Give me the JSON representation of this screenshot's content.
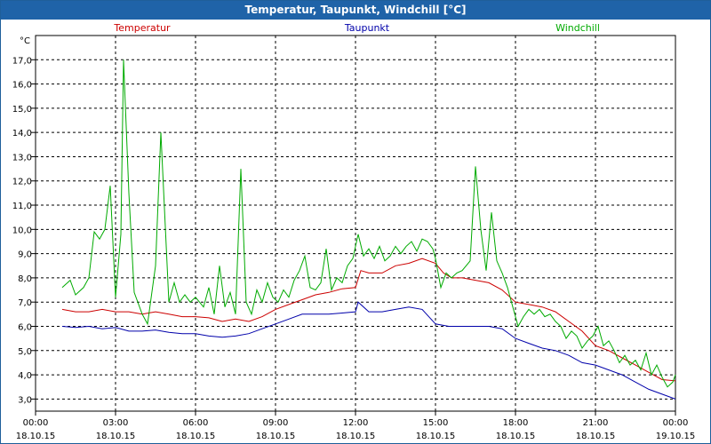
{
  "window": {
    "title": "Temperatur, Taupunkt, Windchill [°C]"
  },
  "chart_data": {
    "type": "line",
    "ylabel": "°C",
    "ylim": [
      2.5,
      18.0
    ],
    "xlim": [
      0,
      24
    ],
    "grid": true,
    "legend_placement": "top",
    "yticks": [
      3.0,
      4.0,
      5.0,
      6.0,
      7.0,
      8.0,
      9.0,
      10.0,
      11.0,
      12.0,
      13.0,
      14.0,
      15.0,
      16.0,
      17.0
    ],
    "ytick_labels": [
      "3,0",
      "4,0",
      "5,0",
      "6,0",
      "7,0",
      "8,0",
      "9,0",
      "10,0",
      "11,0",
      "12,0",
      "13,0",
      "14,0",
      "15,0",
      "16,0",
      "17,0"
    ],
    "xticks": [
      {
        "x": 0,
        "time": "00:00",
        "date": "18.10.15"
      },
      {
        "x": 3,
        "time": "03:00",
        "date": "18.10.15"
      },
      {
        "x": 6,
        "time": "06:00",
        "date": "18.10.15"
      },
      {
        "x": 9,
        "time": "09:00",
        "date": "18.10.15"
      },
      {
        "x": 12,
        "time": "12:00",
        "date": "18.10.15"
      },
      {
        "x": 15,
        "time": "15:00",
        "date": "18.10.15"
      },
      {
        "x": 18,
        "time": "18:00",
        "date": "18.10.15"
      },
      {
        "x": 21,
        "time": "21:00",
        "date": "18.10.15"
      },
      {
        "x": 24,
        "time": "00:00",
        "date": "19.10.15"
      }
    ],
    "series": [
      {
        "name": "Temperatur",
        "color": "#cc0000",
        "points": [
          [
            1.0,
            6.7
          ],
          [
            1.5,
            6.6
          ],
          [
            2.0,
            6.6
          ],
          [
            2.5,
            6.7
          ],
          [
            3.0,
            6.6
          ],
          [
            3.5,
            6.6
          ],
          [
            4.0,
            6.5
          ],
          [
            4.5,
            6.6
          ],
          [
            5.0,
            6.5
          ],
          [
            5.5,
            6.4
          ],
          [
            6.0,
            6.4
          ],
          [
            6.5,
            6.35
          ],
          [
            7.0,
            6.2
          ],
          [
            7.5,
            6.3
          ],
          [
            8.0,
            6.2
          ],
          [
            8.5,
            6.4
          ],
          [
            9.0,
            6.7
          ],
          [
            9.5,
            6.9
          ],
          [
            10.0,
            7.1
          ],
          [
            10.5,
            7.3
          ],
          [
            11.0,
            7.4
          ],
          [
            11.5,
            7.55
          ],
          [
            12.0,
            7.6
          ],
          [
            12.2,
            8.3
          ],
          [
            12.5,
            8.2
          ],
          [
            13.0,
            8.2
          ],
          [
            13.5,
            8.5
          ],
          [
            14.0,
            8.6
          ],
          [
            14.5,
            8.8
          ],
          [
            15.0,
            8.6
          ],
          [
            15.3,
            8.2
          ],
          [
            15.6,
            8.0
          ],
          [
            16.0,
            8.0
          ],
          [
            16.5,
            7.9
          ],
          [
            17.0,
            7.8
          ],
          [
            17.5,
            7.5
          ],
          [
            18.0,
            7.0
          ],
          [
            18.5,
            6.9
          ],
          [
            19.0,
            6.8
          ],
          [
            19.5,
            6.6
          ],
          [
            20.0,
            6.2
          ],
          [
            20.5,
            5.8
          ],
          [
            21.0,
            5.2
          ],
          [
            21.5,
            5.0
          ],
          [
            22.0,
            4.7
          ],
          [
            22.5,
            4.4
          ],
          [
            23.0,
            4.1
          ],
          [
            23.5,
            3.8
          ],
          [
            24.0,
            3.75
          ]
        ]
      },
      {
        "name": "Taupunkt",
        "color": "#0000aa",
        "points": [
          [
            1.0,
            6.0
          ],
          [
            1.5,
            5.95
          ],
          [
            2.0,
            6.0
          ],
          [
            2.5,
            5.9
          ],
          [
            3.0,
            5.95
          ],
          [
            3.5,
            5.8
          ],
          [
            4.0,
            5.8
          ],
          [
            4.5,
            5.85
          ],
          [
            5.0,
            5.75
          ],
          [
            5.5,
            5.7
          ],
          [
            6.0,
            5.7
          ],
          [
            6.5,
            5.6
          ],
          [
            7.0,
            5.55
          ],
          [
            7.5,
            5.6
          ],
          [
            8.0,
            5.7
          ],
          [
            8.5,
            5.9
          ],
          [
            9.0,
            6.1
          ],
          [
            9.5,
            6.3
          ],
          [
            10.0,
            6.5
          ],
          [
            10.5,
            6.5
          ],
          [
            11.0,
            6.5
          ],
          [
            11.5,
            6.55
          ],
          [
            12.0,
            6.6
          ],
          [
            12.1,
            7.0
          ],
          [
            12.5,
            6.6
          ],
          [
            13.0,
            6.6
          ],
          [
            13.5,
            6.7
          ],
          [
            14.0,
            6.8
          ],
          [
            14.5,
            6.7
          ],
          [
            15.0,
            6.1
          ],
          [
            15.5,
            6.0
          ],
          [
            16.0,
            6.0
          ],
          [
            16.5,
            6.0
          ],
          [
            17.0,
            6.0
          ],
          [
            17.5,
            5.9
          ],
          [
            18.0,
            5.5
          ],
          [
            18.5,
            5.3
          ],
          [
            19.0,
            5.1
          ],
          [
            19.5,
            5.0
          ],
          [
            20.0,
            4.8
          ],
          [
            20.5,
            4.5
          ],
          [
            21.0,
            4.4
          ],
          [
            21.5,
            4.2
          ],
          [
            22.0,
            4.0
          ],
          [
            22.5,
            3.7
          ],
          [
            23.0,
            3.4
          ],
          [
            23.5,
            3.2
          ],
          [
            24.0,
            3.0
          ]
        ]
      },
      {
        "name": "Windchill",
        "color": "#00aa00",
        "points": [
          [
            1.0,
            7.6
          ],
          [
            1.3,
            7.9
          ],
          [
            1.5,
            7.3
          ],
          [
            1.8,
            7.6
          ],
          [
            2.0,
            8.0
          ],
          [
            2.2,
            9.9
          ],
          [
            2.4,
            9.6
          ],
          [
            2.6,
            10.0
          ],
          [
            2.8,
            11.8
          ],
          [
            3.0,
            7.2
          ],
          [
            3.2,
            9.8
          ],
          [
            3.3,
            17.0
          ],
          [
            3.5,
            11.5
          ],
          [
            3.7,
            7.4
          ],
          [
            4.0,
            6.5
          ],
          [
            4.2,
            6.1
          ],
          [
            4.5,
            8.5
          ],
          [
            4.7,
            14.0
          ],
          [
            5.0,
            7.0
          ],
          [
            5.2,
            7.8
          ],
          [
            5.4,
            7.0
          ],
          [
            5.6,
            7.3
          ],
          [
            5.8,
            7.0
          ],
          [
            6.0,
            7.2
          ],
          [
            6.3,
            6.8
          ],
          [
            6.5,
            7.6
          ],
          [
            6.7,
            6.5
          ],
          [
            6.9,
            8.5
          ],
          [
            7.1,
            6.8
          ],
          [
            7.3,
            7.4
          ],
          [
            7.5,
            6.5
          ],
          [
            7.7,
            12.5
          ],
          [
            7.9,
            7.0
          ],
          [
            8.1,
            6.5
          ],
          [
            8.3,
            7.5
          ],
          [
            8.5,
            7.0
          ],
          [
            8.7,
            7.8
          ],
          [
            8.9,
            7.2
          ],
          [
            9.1,
            7.0
          ],
          [
            9.3,
            7.5
          ],
          [
            9.5,
            7.2
          ],
          [
            9.7,
            7.9
          ],
          [
            9.9,
            8.3
          ],
          [
            10.1,
            8.9
          ],
          [
            10.3,
            7.6
          ],
          [
            10.5,
            7.5
          ],
          [
            10.7,
            7.8
          ],
          [
            10.9,
            9.2
          ],
          [
            11.1,
            7.5
          ],
          [
            11.3,
            8.0
          ],
          [
            11.5,
            7.8
          ],
          [
            11.7,
            8.5
          ],
          [
            11.9,
            8.8
          ],
          [
            12.1,
            9.8
          ],
          [
            12.3,
            8.9
          ],
          [
            12.5,
            9.2
          ],
          [
            12.7,
            8.8
          ],
          [
            12.9,
            9.3
          ],
          [
            13.1,
            8.7
          ],
          [
            13.3,
            8.9
          ],
          [
            13.5,
            9.3
          ],
          [
            13.7,
            9.0
          ],
          [
            13.9,
            9.3
          ],
          [
            14.1,
            9.5
          ],
          [
            14.3,
            9.1
          ],
          [
            14.5,
            9.6
          ],
          [
            14.7,
            9.5
          ],
          [
            14.9,
            9.2
          ],
          [
            15.0,
            8.8
          ],
          [
            15.2,
            7.6
          ],
          [
            15.4,
            8.2
          ],
          [
            15.6,
            8.0
          ],
          [
            15.8,
            8.2
          ],
          [
            16.0,
            8.3
          ],
          [
            16.3,
            8.7
          ],
          [
            16.5,
            12.6
          ],
          [
            16.7,
            10.0
          ],
          [
            16.9,
            8.3
          ],
          [
            17.1,
            10.7
          ],
          [
            17.3,
            8.7
          ],
          [
            17.5,
            8.2
          ],
          [
            17.7,
            7.6
          ],
          [
            17.9,
            6.8
          ],
          [
            18.1,
            6.0
          ],
          [
            18.3,
            6.4
          ],
          [
            18.5,
            6.7
          ],
          [
            18.7,
            6.5
          ],
          [
            18.9,
            6.7
          ],
          [
            19.1,
            6.4
          ],
          [
            19.3,
            6.5
          ],
          [
            19.5,
            6.2
          ],
          [
            19.7,
            6.0
          ],
          [
            19.9,
            5.5
          ],
          [
            20.1,
            5.8
          ],
          [
            20.3,
            5.6
          ],
          [
            20.5,
            5.1
          ],
          [
            20.7,
            5.4
          ],
          [
            20.9,
            5.6
          ],
          [
            21.1,
            6.0
          ],
          [
            21.3,
            5.2
          ],
          [
            21.5,
            5.4
          ],
          [
            21.7,
            5.0
          ],
          [
            21.9,
            4.5
          ],
          [
            22.1,
            4.8
          ],
          [
            22.3,
            4.4
          ],
          [
            22.5,
            4.6
          ],
          [
            22.7,
            4.2
          ],
          [
            22.9,
            4.9
          ],
          [
            23.1,
            4.0
          ],
          [
            23.3,
            4.4
          ],
          [
            23.5,
            3.9
          ],
          [
            23.7,
            3.5
          ],
          [
            23.9,
            3.7
          ],
          [
            24.0,
            4.0
          ]
        ]
      }
    ]
  }
}
